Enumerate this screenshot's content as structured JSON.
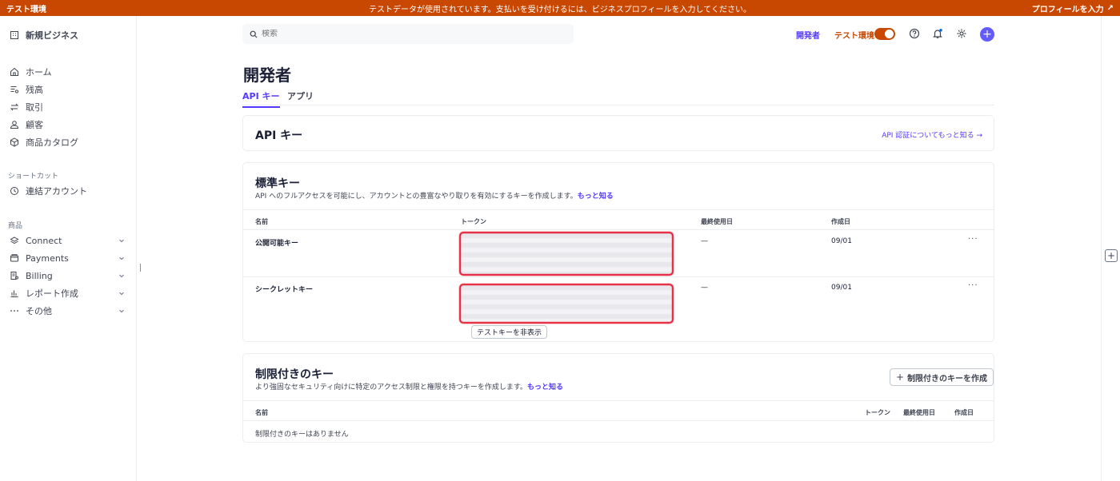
{
  "banner": {
    "env_label": "テスト環境",
    "message": "テストデータが使用されています。支払いを受け付けるには、ビジネスプロフィールを入力してください。",
    "profile_link": "プロフィールを入力",
    "profile_arrow": "↗"
  },
  "sidebar": {
    "account_name": "新規ビジネス",
    "items": [
      {
        "label": "ホーム",
        "icon": "home-icon"
      },
      {
        "label": "残高",
        "icon": "balance-icon"
      },
      {
        "label": "取引",
        "icon": "transactions-icon"
      },
      {
        "label": "顧客",
        "icon": "customer-icon"
      },
      {
        "label": "商品カタログ",
        "icon": "product-catalog-icon"
      }
    ],
    "shortcuts_heading": "ショートカット",
    "shortcuts": [
      {
        "label": "連結アカウント",
        "icon": "clock-icon"
      }
    ],
    "products_heading": "商品",
    "products": [
      {
        "label": "Connect",
        "icon": "connect-icon"
      },
      {
        "label": "Payments",
        "icon": "payments-icon"
      },
      {
        "label": "Billing",
        "icon": "billing-icon"
      },
      {
        "label": "レポート作成",
        "icon": "reporting-icon"
      },
      {
        "label": "その他",
        "icon": "more-icon"
      }
    ]
  },
  "topbar": {
    "search_placeholder": "検索",
    "developers_link": "開発者",
    "test_env_label": "テスト環境",
    "test_mode_on": true,
    "create_button": "+"
  },
  "page": {
    "title": "開発者",
    "tabs": [
      {
        "label": "API キー",
        "active": true
      },
      {
        "label": "アプリ",
        "active": false
      }
    ]
  },
  "api_keys_card": {
    "title": "API キー",
    "learn_more": "API 認証についてもっと知る →"
  },
  "standard_keys": {
    "title": "標準キー",
    "subtitle": "API へのフルアクセスを可能にし、アカウントとの豊富なやり取りを有効にするキーを作成します。",
    "learn_more": "もっと知る",
    "columns": {
      "name": "名前",
      "token": "トークン",
      "last_used": "最終使用日",
      "created": "作成日"
    },
    "rows": [
      {
        "name": "公開可能キー",
        "last_used": "—",
        "created": "09/01",
        "more": "···"
      },
      {
        "name": "シークレットキー",
        "last_used": "—",
        "created": "09/01",
        "more": "···"
      }
    ],
    "hide_test_key_button": "テストキーを非表示"
  },
  "restricted_keys": {
    "title": "制限付きのキー",
    "subtitle": "より強固なセキュリティ向けに特定のアクセス制限と権限を持つキーを作成します。",
    "learn_more": "もっと知る",
    "create_button": "制限付きのキーを作成",
    "create_icon": "+",
    "columns": {
      "name": "名前",
      "token": "トークン",
      "last_used": "最終使用日",
      "created": "作成日"
    },
    "empty_text": "制限付きのキーはありません"
  },
  "right_rail": {
    "add_label": "+"
  }
}
